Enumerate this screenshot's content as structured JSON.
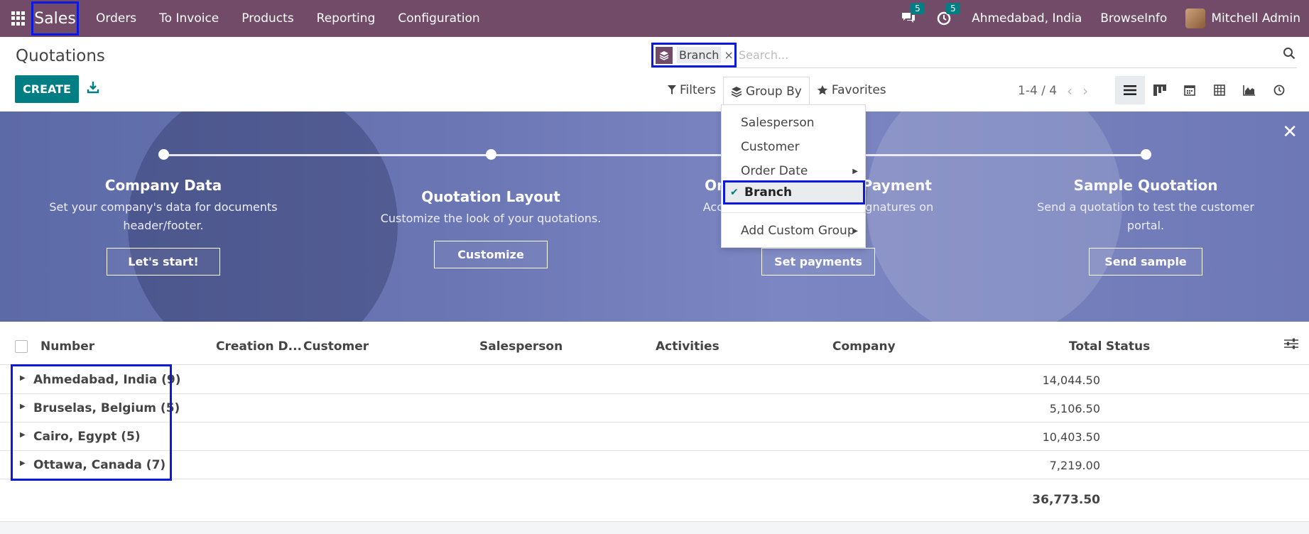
{
  "navbar": {
    "app_name": "Sales",
    "menu": [
      "Orders",
      "To Invoice",
      "Products",
      "Reporting",
      "Configuration"
    ],
    "messages_count": "5",
    "activities_count": "5",
    "company_branch": "Ahmedabad, India",
    "company": "BrowseInfo",
    "user": "Mitchell Admin",
    "bg_color": "#714b67"
  },
  "control_panel": {
    "title": "Quotations",
    "create_label": "CREATE",
    "search": {
      "facet_label": "Branch",
      "facet_close": "×",
      "placeholder": "Search..."
    },
    "filters_label": "Filters",
    "groupby_label": "Group By",
    "favorites_label": "Favorites",
    "pager": "1-4 / 4",
    "active_view": "list"
  },
  "groupby_dropdown": {
    "items": [
      {
        "label": "Salesperson"
      },
      {
        "label": "Customer"
      },
      {
        "label": "Order Date",
        "submenu": true
      },
      {
        "label": "Branch",
        "selected": true
      },
      {
        "label": "Add Custom Group",
        "submenu": true
      }
    ]
  },
  "onboarding": {
    "steps": [
      {
        "title": "Company Data",
        "desc": "Set your company's data for documents header/footer.",
        "button": "Let's start!"
      },
      {
        "title": "Quotation Layout",
        "desc": "Customize the look of your quotations.",
        "button": "Customize"
      },
      {
        "title": "Online Signature & Payment",
        "desc": "Accept online payments & signatures on quotations.",
        "button": "Set payments"
      },
      {
        "title": "Sample Quotation",
        "desc": "Send a quotation to test the customer portal.",
        "button": "Send sample"
      }
    ]
  },
  "list": {
    "columns": [
      "Number",
      "Creation D...",
      "Customer",
      "Salesperson",
      "Activities",
      "Company",
      "Total",
      "Status"
    ],
    "groups": [
      {
        "name": "Ahmedabad, India (9)",
        "total": "14,044.50"
      },
      {
        "name": "Bruselas, Belgium (5)",
        "total": "5,106.50"
      },
      {
        "name": "Cairo, Egypt (5)",
        "total": "10,403.50"
      },
      {
        "name": "Ottawa, Canada (7)",
        "total": "7,219.00"
      }
    ],
    "grand_total": "36,773.50"
  }
}
